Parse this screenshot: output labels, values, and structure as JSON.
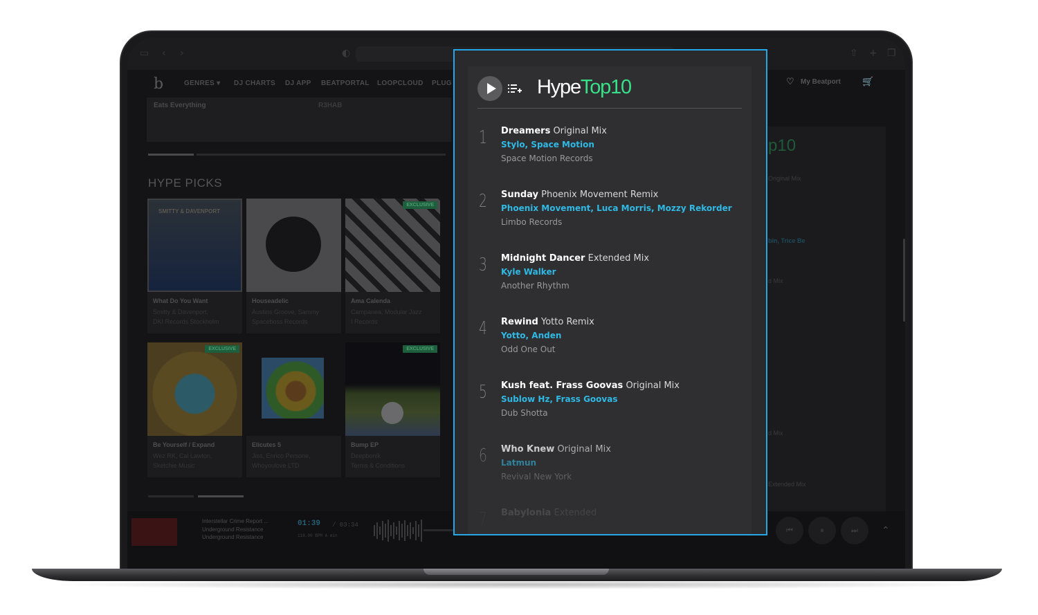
{
  "site_nav": {
    "items": [
      "GENRES ▾",
      "DJ CHARTS",
      "DJ APP",
      "BEATPORTAL",
      "LOOPCLOUD",
      "PLUG"
    ],
    "my_beatport": "My Beatport"
  },
  "background": {
    "banner_left": "Eats Everything",
    "banner_right": "R3HAB",
    "section_title": "HYPE PICKS",
    "exclusive_label": "EXCLUSIVE",
    "cards": [
      {
        "title": "What Do You Want",
        "artist": "Smitty & Davenport,",
        "label": "DKI Records Stockholm",
        "art_text": "SMITTY & DAVENPORT"
      },
      {
        "title": "Houseadelic",
        "artist": "Austins Groove, Sammy",
        "label": "Spaceboss Records"
      },
      {
        "title": "Ama Calenda",
        "artist": "Campanea, Modular Jazz",
        "label": "I Records",
        "exclusive": true
      },
      {
        "title": "Be Yourself / Expand",
        "artist": "Wez RK, Cal Lawton,",
        "label": "Sketchie Music",
        "exclusive": true
      },
      {
        "title": "Elicutes 5",
        "artist": "Jiss, Enrico Persone,",
        "label": "Whoyoulove LTD"
      },
      {
        "title": "Bump EP",
        "artist": "Deepbonik",
        "label": "Terms & Conditions",
        "exclusive": true
      }
    ],
    "right_panel": [
      "p10",
      "Original Mix",
      "bin, Trice Be",
      "d Mix",
      "d Mix",
      "Extended Mix"
    ]
  },
  "player": {
    "title": "Interstellar Crime Report ...",
    "artist": "Underground Resistance",
    "label": "Underground Resistance",
    "time": "01:39",
    "duration": "/ 03:34",
    "bpm_key": "118.00 BPM     A min"
  },
  "hype_top10": {
    "title_hype": "Hype",
    "title_top": "Top10",
    "tracks": [
      {
        "num": "1",
        "name": "Dreamers",
        "mix": "Original Mix",
        "artists": "Stylo, Space Motion",
        "label": "Space Motion Records"
      },
      {
        "num": "2",
        "name": "Sunday",
        "mix": "Phoenix Movement Remix",
        "artists": "Phoenix Movement, Luca Morris, Mozzy Rekorder",
        "label": "Limbo Records"
      },
      {
        "num": "3",
        "name": "Midnight Dancer",
        "mix": "Extended Mix",
        "artists": "Kyle Walker",
        "label": "Another Rhythm"
      },
      {
        "num": "4",
        "name": "Rewind",
        "mix": "Yotto Remix",
        "artists": "Yotto, Anden",
        "label": "Odd One Out"
      },
      {
        "num": "5",
        "name": "Kush feat. Frass Goovas",
        "mix": "Original Mix",
        "artists": "Sublow Hz, Frass Goovas",
        "label": "Dub Shotta"
      },
      {
        "num": "6",
        "name": "Who Knew",
        "mix": "Original Mix",
        "artists": "Latmun",
        "label": "Revival New York"
      },
      {
        "num": "7",
        "name": "Babylonia",
        "mix": "Extended",
        "artists": "",
        "label": ""
      }
    ]
  },
  "colors": {
    "highlight_border": "#26a8e8",
    "artist_blue": "#2fb9e4",
    "top10_green": "#38e08a"
  }
}
